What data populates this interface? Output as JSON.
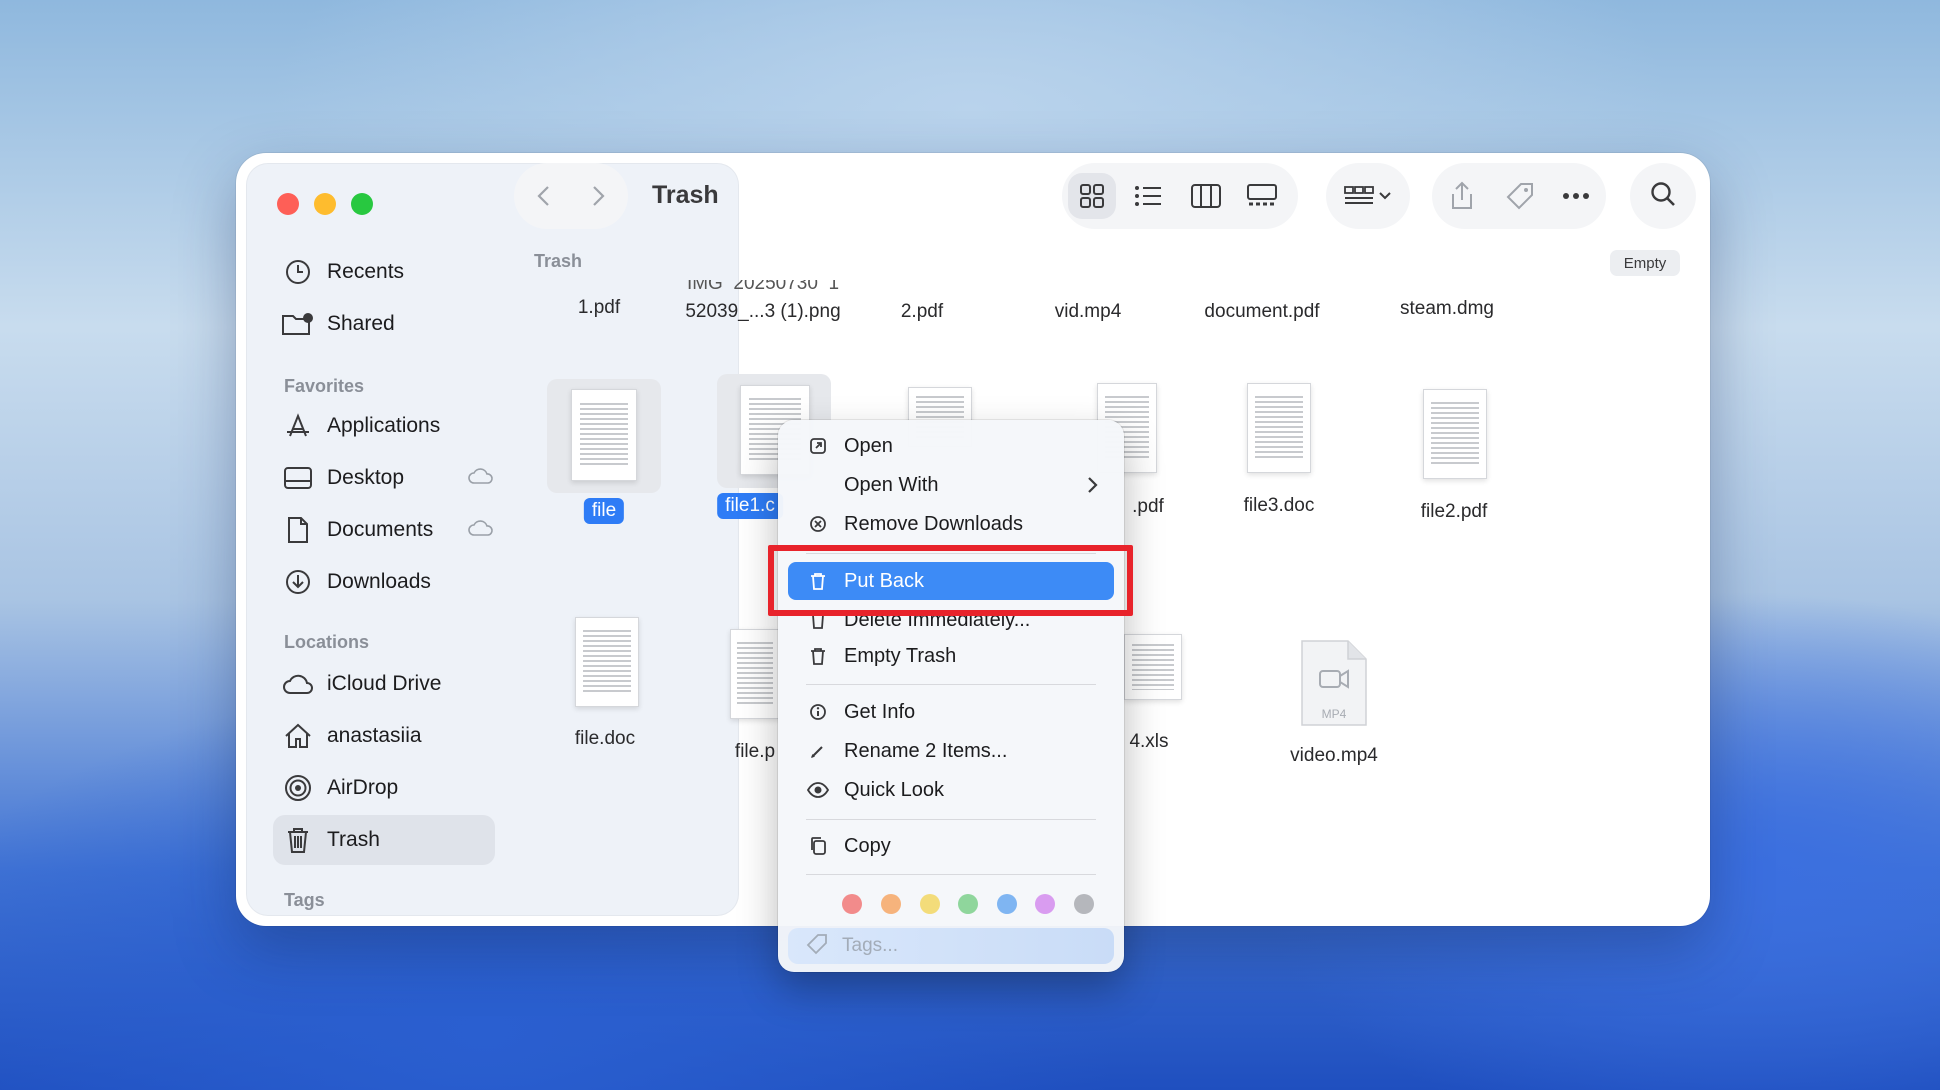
{
  "window": {
    "title": "Trash"
  },
  "sidebar": {
    "top_items": [
      {
        "label": "Recents",
        "icon": "clock-icon"
      },
      {
        "label": "Shared",
        "icon": "shared-folder-icon"
      }
    ],
    "favorites_title": "Favorites",
    "favorites": [
      {
        "label": "Applications",
        "icon": "applications-icon"
      },
      {
        "label": "Desktop",
        "icon": "desktop-icon"
      },
      {
        "label": "Documents",
        "icon": "document-icon"
      },
      {
        "label": "Downloads",
        "icon": "download-icon"
      }
    ],
    "locations_title": "Locations",
    "locations": [
      {
        "label": "iCloud Drive",
        "icon": "cloud-icon"
      },
      {
        "label": "anastasiia",
        "icon": "home-icon"
      },
      {
        "label": "AirDrop",
        "icon": "airdrop-icon"
      },
      {
        "label": "Trash",
        "icon": "trash-icon",
        "selected": true
      }
    ],
    "tags_title": "Tags"
  },
  "content": {
    "path_label": "Trash",
    "empty_button": "Empty",
    "row1": [
      "1.pdf",
      "52039_...3 (1).png",
      "2.pdf",
      "vid.mp4",
      "document.pdf",
      "steam.dmg"
    ],
    "row1_partial": "IMG_20250730_1",
    "row2": [
      "file",
      "file1.c",
      ".pdf",
      "file3.doc",
      "file2.pdf"
    ],
    "row3": [
      "file.doc",
      "file.p",
      "4.xls",
      "video.mp4"
    ],
    "mp4_badge": "MP4"
  },
  "context_menu": {
    "items": [
      {
        "label": "Open",
        "icon": "open-icon"
      },
      {
        "label": "Open With",
        "icon": "none"
      },
      {
        "label": "Remove Downloads",
        "icon": "remove-circle-icon"
      },
      {
        "label": "Put Back",
        "icon": "trash-icon",
        "highlighted": true
      },
      {
        "label": "Delete Immediately...",
        "icon": "trash-icon"
      },
      {
        "label": "Empty Trash",
        "icon": "trash-icon"
      },
      {
        "label": "Get Info",
        "icon": "info-icon"
      },
      {
        "label": "Rename 2 Items...",
        "icon": "pencil-icon"
      },
      {
        "label": "Quick Look",
        "icon": "eye-icon"
      },
      {
        "label": "Copy",
        "icon": "copy-icon"
      }
    ],
    "tag_colors": [
      "#f28b8b",
      "#f6b37c",
      "#f3dc7a",
      "#8fd69c",
      "#7fb5f2",
      "#d99cf0",
      "#b5b7bc"
    ],
    "tags_placeholder": "Tags..."
  },
  "colors": {
    "accent": "#2e7cf6",
    "highlight_border": "#e8232b"
  }
}
